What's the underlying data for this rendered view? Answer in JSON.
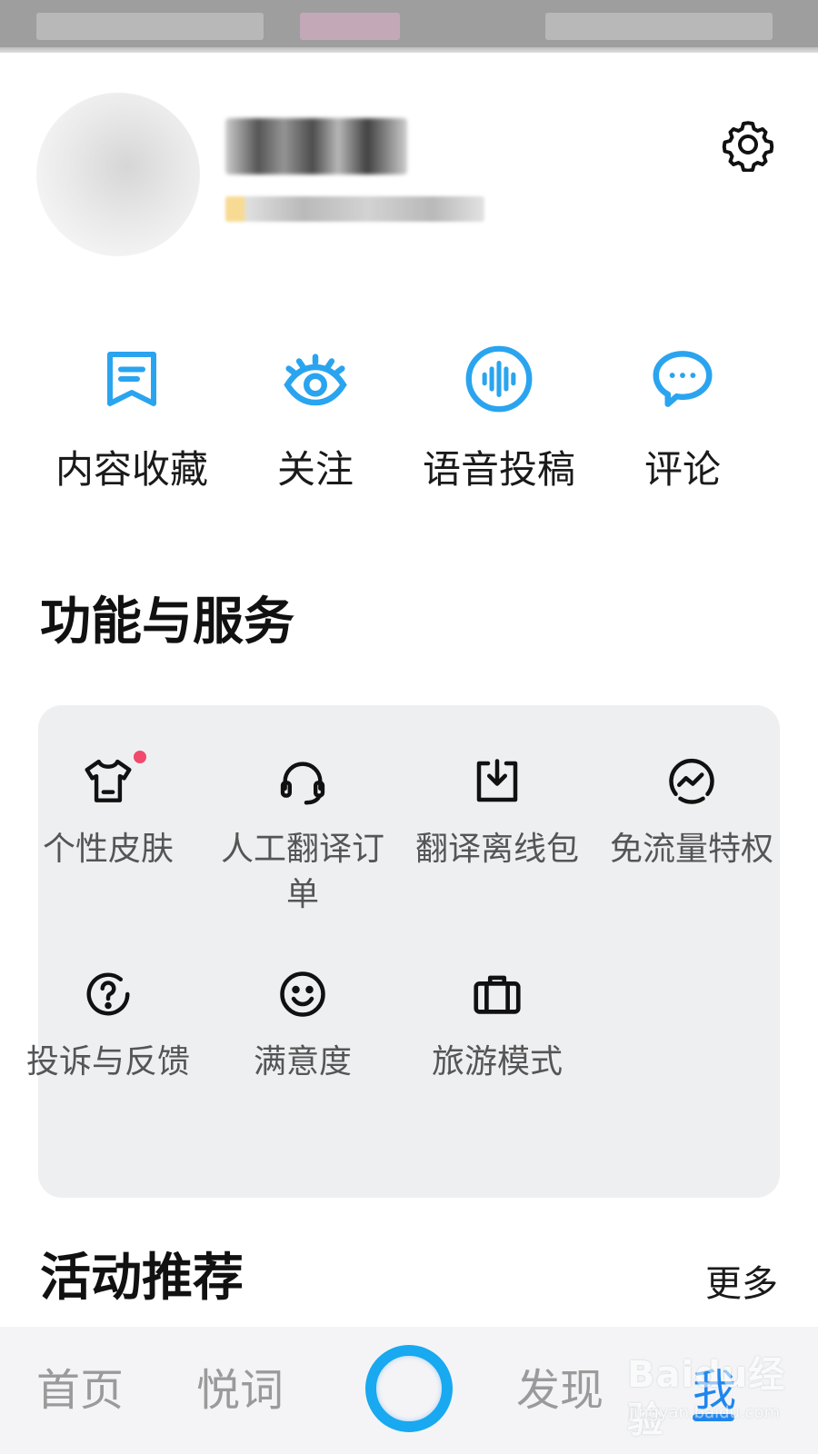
{
  "quick_actions": [
    {
      "label": "内容收藏",
      "icon": "bookmark-icon"
    },
    {
      "label": "关注",
      "icon": "eye-icon"
    },
    {
      "label": "语音投稿",
      "icon": "voice-wave-icon"
    },
    {
      "label": "评论",
      "icon": "comment-bubble-icon"
    }
  ],
  "services": {
    "title": "功能与服务",
    "items": [
      {
        "label": "个性皮肤",
        "icon": "tshirt-icon",
        "badge": true
      },
      {
        "label": "人工翻译订单",
        "icon": "headset-icon",
        "badge": false
      },
      {
        "label": "翻译离线包",
        "icon": "download-icon",
        "badge": false
      },
      {
        "label": "免流量特权",
        "icon": "traffic-chart-icon",
        "badge": false
      },
      {
        "label": "投诉与反馈",
        "icon": "question-icon",
        "badge": false
      },
      {
        "label": "满意度",
        "icon": "smiley-icon",
        "badge": false
      },
      {
        "label": "旅游模式",
        "icon": "suitcase-icon",
        "badge": false
      }
    ]
  },
  "activities": {
    "title": "活动推荐",
    "more": "更多"
  },
  "bottom_nav": {
    "items": [
      {
        "label": "首页",
        "active": false
      },
      {
        "label": "悦词",
        "active": false
      },
      {
        "label": "发现",
        "active": false
      },
      {
        "label": "我",
        "active": true
      }
    ],
    "center_button": "assistant-ring-icon"
  },
  "watermark": {
    "brand": "Baidu经验",
    "url": "jingyan.baidu.com"
  },
  "colors": {
    "accent": "#1e86f0",
    "icon_blue": "#2aa4ef",
    "card_bg": "#eeeff1",
    "badge_red": "#f2496d"
  }
}
